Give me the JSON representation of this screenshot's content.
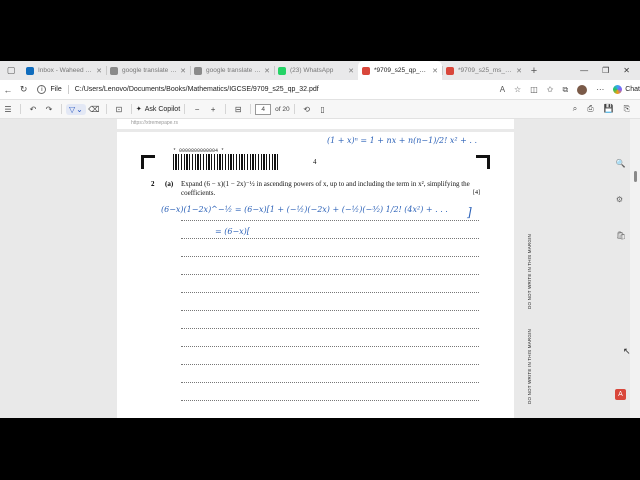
{
  "tabs": [
    {
      "title": "Inbox - Waheed Ahe",
      "color": "#0f6cbd",
      "active": false
    },
    {
      "title": "google translate - Se",
      "color": "#8a8a8a",
      "active": false
    },
    {
      "title": "google translate - Se",
      "color": "#8a8a8a",
      "active": false
    },
    {
      "title": "(23) WhatsApp",
      "color": "#25d366",
      "active": false
    },
    {
      "title": "*9709_s25_qp_32.pdf",
      "color": "#d9473b",
      "active": true
    },
    {
      "title": "*9709_s25_ms_32.pdf",
      "color": "#d9473b",
      "active": false
    }
  ],
  "address": {
    "scheme": "File",
    "path": "C:/Users/Lenovo/Documents/Books/Mathematics/IGCSE/9709_s25_qp_32.pdf"
  },
  "copilot_label": "Chat",
  "pdf_toolbar": {
    "ask_copilot": "Ask Copilot",
    "page_current": "4",
    "page_total": "of 20"
  },
  "page": {
    "prev_watermark": "https://xtremepape.rs",
    "barcode_number": "* 0000800000004 *",
    "page_number": "4",
    "question_number": "2",
    "question_part": "(a)",
    "question_text": "Expand (6 − x)(1 − 2x)⁻½ in ascending powers of x, up to and including the term in x², simplifying the coefficients.",
    "marks": "[4]"
  },
  "handwriting": {
    "top": "(1 + x)ⁿ = 1 + nx + n(n−1)/2! x² + . .",
    "line1": "(6−x)(1−2x)^−½ = (6−x)[1 + (−½)(−2x) + (−½)(−³⁄₂) 1/2! (4x²) + . . .",
    "line2": "= (6−x)["
  },
  "margin_label": "DO NOT WRITE IN THIS MARGIN"
}
